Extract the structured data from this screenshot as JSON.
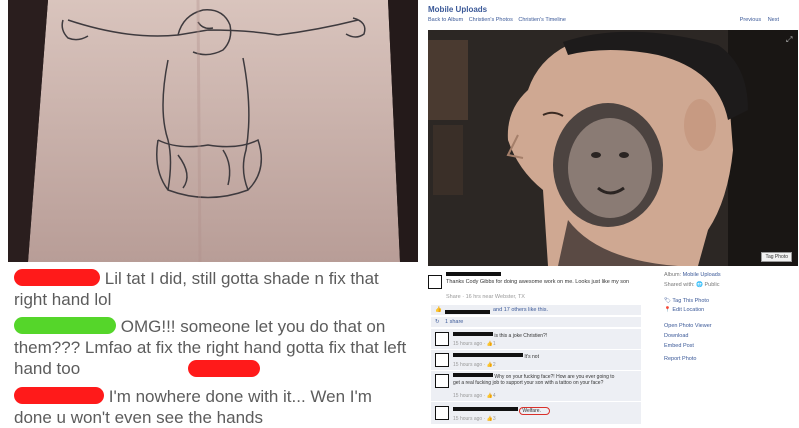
{
  "left_post": {
    "comments": [
      {
        "text": "Lil tat I did, still gotta shade n fix that right hand lol",
        "redact_color": "#ff1a1a"
      },
      {
        "text": "OMG!!! someone let you do that on them??? Lmfao at fix the right hand gotta fix that left hand too",
        "redact_color": "#55d62a",
        "redact2_color": "#ff1a1a"
      },
      {
        "text": "I'm nowhere done with it... Wen I'm done u won't even see the hands",
        "redact_color": "#ff1a1a"
      }
    ]
  },
  "fb": {
    "album_title": "Mobile Uploads",
    "breadcrumbs": [
      "Back to Album",
      "Christien's Photos",
      "Christien's Timeline"
    ],
    "nav": {
      "previous": "Previous",
      "next": "Next"
    },
    "tag_photo_button": "Tag Photo",
    "caption": "Thanks Cody Gibbs for doing awesome work on me. Looks just like my son",
    "caption_meta": "Share · 16 hrs near Webster, TX",
    "likes": "and 17 others like this.",
    "shares": "1 share",
    "sidebar": {
      "album_label": "Album:",
      "album_value": "Mobile Uploads",
      "shared_label": "Shared with:",
      "shared_value": "Public",
      "actions": [
        "Tag This Photo",
        "Edit Location",
        "Open Photo Viewer",
        "Download",
        "Embed Post",
        "Report Photo"
      ]
    },
    "comments": [
      {
        "text": "is this a joke Christien?!",
        "meta": "15 hours ago · 👍1"
      },
      {
        "text": "It's not",
        "meta": "15 hours ago · 👍2"
      },
      {
        "text": "Why on your fucking face?! How are you ever going to get a real fucking job to support your son with a tattoo on your face?",
        "meta": "15 hours ago · 👍4"
      },
      {
        "text": "Welfare.",
        "meta": "15 hours ago · 👍3"
      }
    ],
    "colors": {
      "link": "#3b5998",
      "highlight_circle": "#d9302a"
    }
  }
}
